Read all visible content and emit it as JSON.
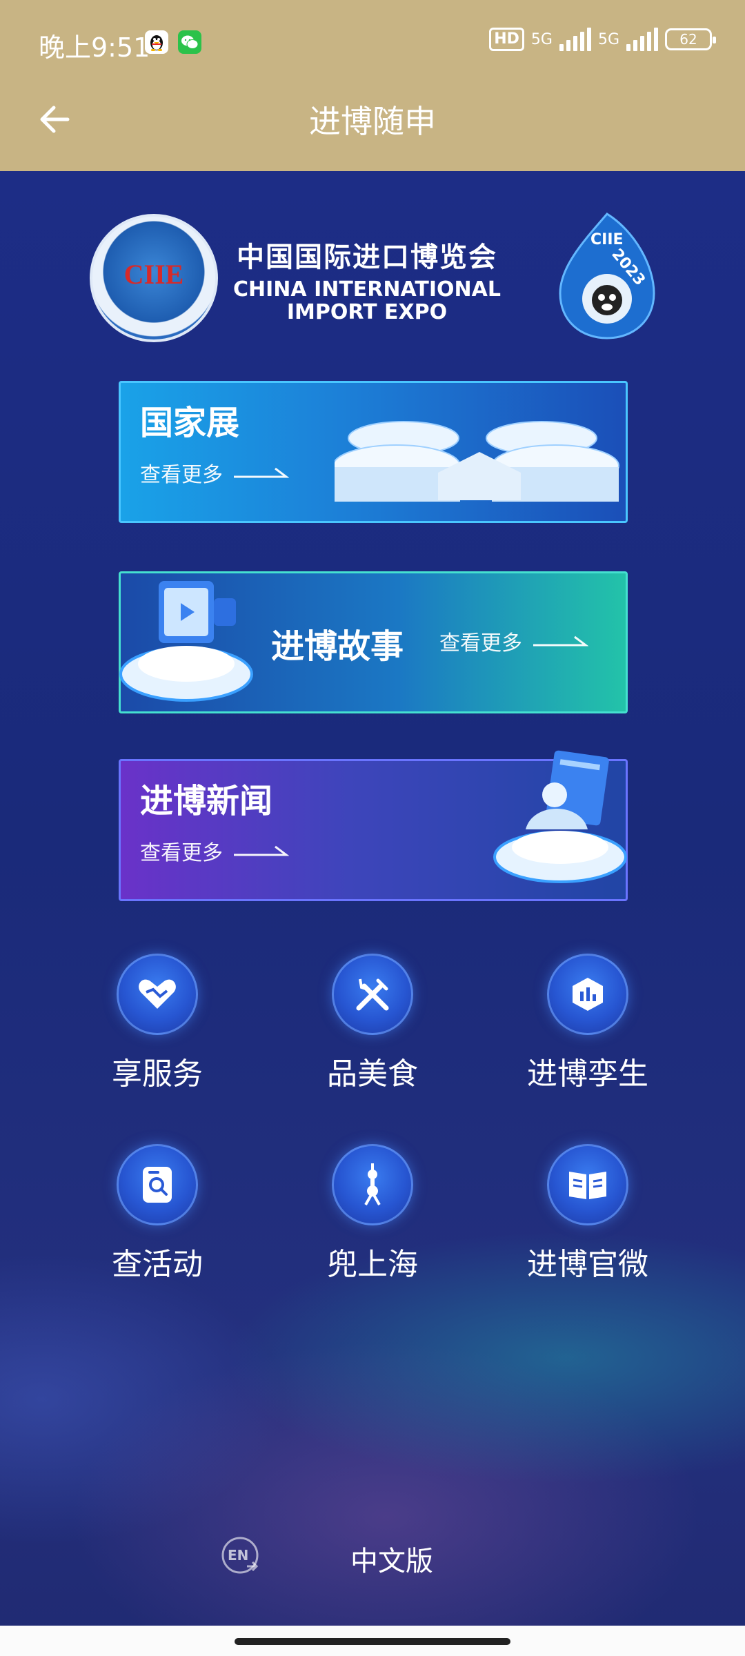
{
  "status_bar": {
    "time": "晚上9:51",
    "hd_label": "HD",
    "signal1_label": "5G",
    "signal2_label": "5G",
    "battery": "62"
  },
  "header": {
    "title": "进博随申"
  },
  "logo": {
    "seal_text": "CIIE",
    "cn": "中国国际进口博览会",
    "en_line1": "CHINA INTERNATIONAL",
    "en_line2": "IMPORT EXPO",
    "badge_text": "CIIE",
    "badge_year": "2023"
  },
  "cards": [
    {
      "title": "国家展",
      "more": "查看更多"
    },
    {
      "title": "进博故事",
      "more": "查看更多"
    },
    {
      "title": "进博新闻",
      "more": "查看更多"
    }
  ],
  "services": [
    {
      "label": "享服务",
      "icon": "handshake-heart-icon"
    },
    {
      "label": "品美食",
      "icon": "fork-knife-icon"
    },
    {
      "label": "进博孪生",
      "icon": "building-chart-icon"
    },
    {
      "label": "查活动",
      "icon": "document-search-icon"
    },
    {
      "label": "兜上海",
      "icon": "tv-tower-icon"
    },
    {
      "label": "进博官微",
      "icon": "open-book-icon"
    }
  ],
  "language": {
    "en_icon_text": "EN",
    "current": "中文版"
  },
  "colors": {
    "header_bg": "#c8b484",
    "page_bg": "#1b2a7e",
    "accent_cyan": "#49c6ff",
    "accent_teal": "#23c3a9",
    "accent_purple": "#6a32c9"
  }
}
